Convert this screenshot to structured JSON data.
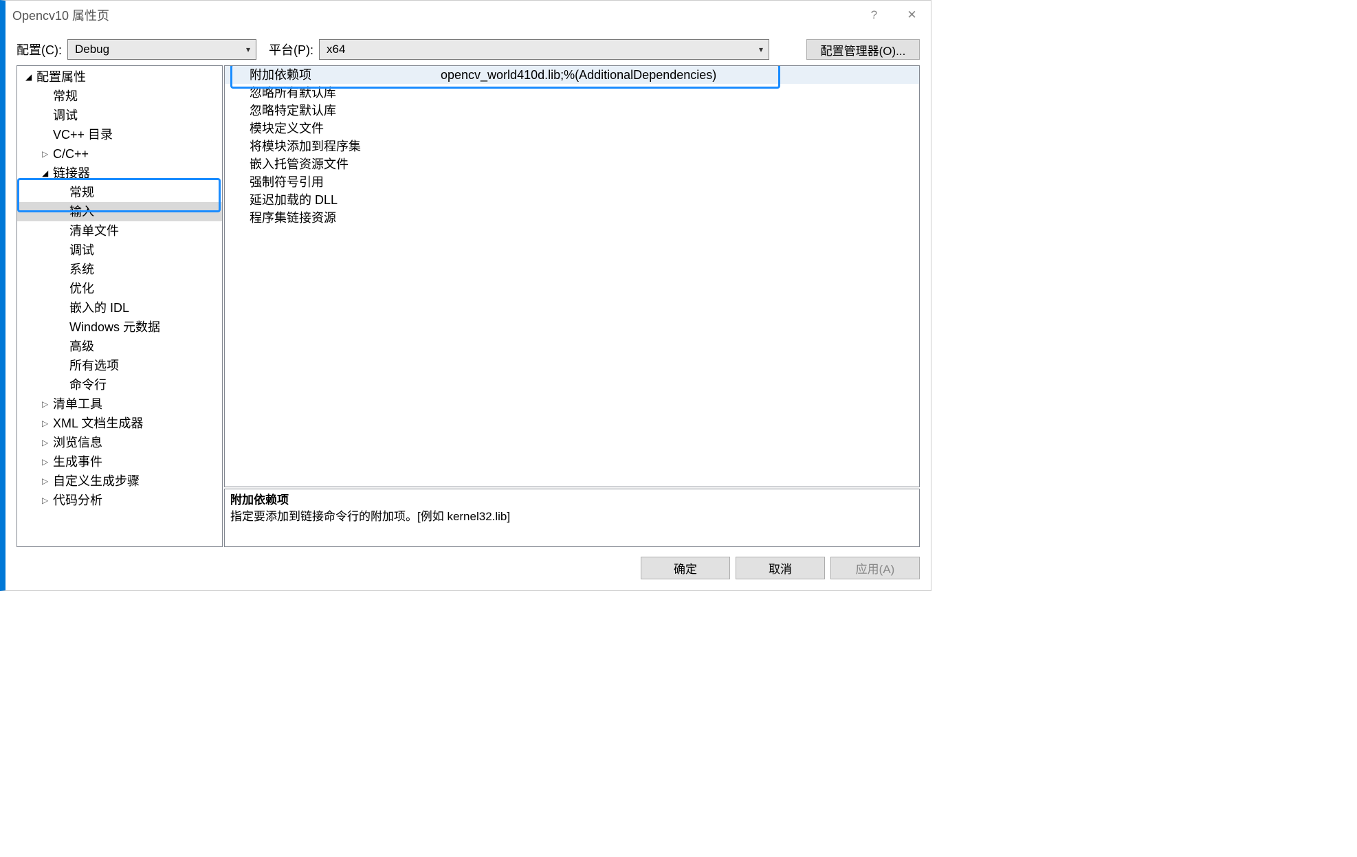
{
  "title": "Opencv10 属性页",
  "help": "?",
  "close": "✕",
  "topRow": {
    "configLabel": "配置(C):",
    "configValue": "Debug",
    "platformLabel": "平台(P):",
    "platformValue": "x64",
    "managerBtn": "配置管理器(O)..."
  },
  "tree": [
    {
      "level": 0,
      "exp": "open",
      "label": "配置属性"
    },
    {
      "level": 1,
      "exp": "none",
      "label": "常规"
    },
    {
      "level": 1,
      "exp": "none",
      "label": "调试"
    },
    {
      "level": 1,
      "exp": "none",
      "label": "VC++ 目录"
    },
    {
      "level": 1,
      "exp": "closed",
      "label": "C/C++"
    },
    {
      "level": 1,
      "exp": "open",
      "label": "链接器"
    },
    {
      "level": 2,
      "exp": "none",
      "label": "常规"
    },
    {
      "level": 2,
      "exp": "none",
      "label": "输入",
      "selected": true
    },
    {
      "level": 2,
      "exp": "none",
      "label": "清单文件"
    },
    {
      "level": 2,
      "exp": "none",
      "label": "调试"
    },
    {
      "level": 2,
      "exp": "none",
      "label": "系统"
    },
    {
      "level": 2,
      "exp": "none",
      "label": "优化"
    },
    {
      "level": 2,
      "exp": "none",
      "label": "嵌入的 IDL"
    },
    {
      "level": 2,
      "exp": "none",
      "label": "Windows 元数据"
    },
    {
      "level": 2,
      "exp": "none",
      "label": "高级"
    },
    {
      "level": 2,
      "exp": "none",
      "label": "所有选项"
    },
    {
      "level": 2,
      "exp": "none",
      "label": "命令行"
    },
    {
      "level": 1,
      "exp": "closed",
      "label": "清单工具"
    },
    {
      "level": 1,
      "exp": "closed",
      "label": "XML 文档生成器"
    },
    {
      "level": 1,
      "exp": "closed",
      "label": "浏览信息"
    },
    {
      "level": 1,
      "exp": "closed",
      "label": "生成事件"
    },
    {
      "level": 1,
      "exp": "closed",
      "label": "自定义生成步骤"
    },
    {
      "level": 1,
      "exp": "closed",
      "label": "代码分析"
    }
  ],
  "grid": [
    {
      "k": "附加依赖项",
      "v": "opencv_world410d.lib;%(AdditionalDependencies)",
      "selected": true
    },
    {
      "k": "忽略所有默认库",
      "v": ""
    },
    {
      "k": "忽略特定默认库",
      "v": ""
    },
    {
      "k": "模块定义文件",
      "v": ""
    },
    {
      "k": "将模块添加到程序集",
      "v": ""
    },
    {
      "k": "嵌入托管资源文件",
      "v": ""
    },
    {
      "k": "强制符号引用",
      "v": ""
    },
    {
      "k": "延迟加载的 DLL",
      "v": ""
    },
    {
      "k": "程序集链接资源",
      "v": ""
    }
  ],
  "desc": {
    "title": "附加依赖项",
    "text": "指定要添加到链接命令行的附加项。[例如 kernel32.lib]"
  },
  "footer": {
    "ok": "确定",
    "cancel": "取消",
    "apply": "应用(A)"
  }
}
